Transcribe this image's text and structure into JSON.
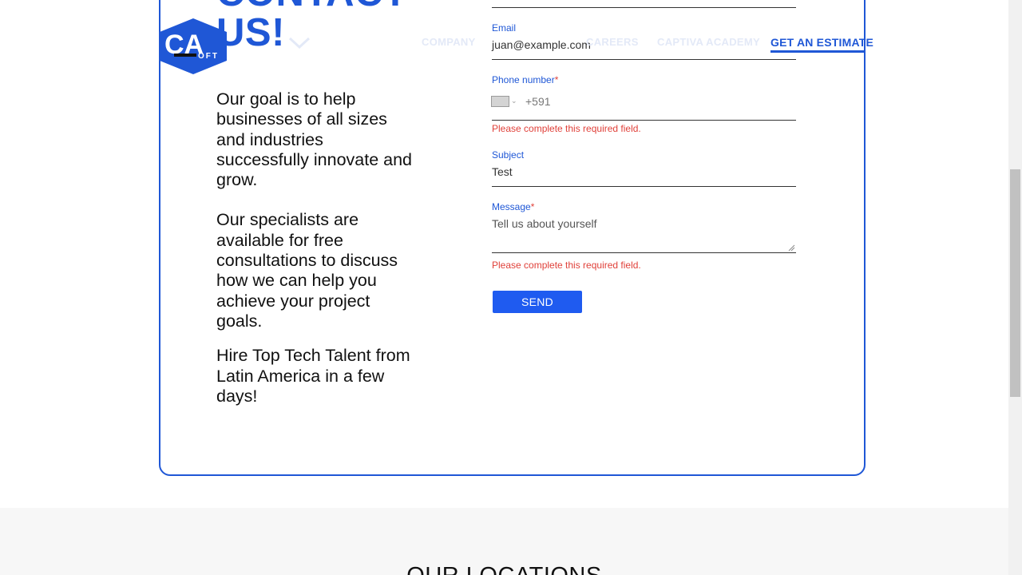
{
  "header": {
    "logo_text": "CA",
    "logo_subtext": "OFT",
    "nav": [
      "COMPANY",
      "CAREERS",
      "CAPTIVA ACADEMY"
    ],
    "cta": "GET AN ESTIMATE"
  },
  "contact": {
    "heading_line1": "CONTACT",
    "heading_line2": "US!",
    "paragraphs": [
      "Our goal is to help businesses of all sizes and industries successfully innovate and grow.",
      "Our specialists are available for free consultations to discuss how we can help you achieve your project goals.",
      "Hire Top Tech Talent from Latin America in a few days!"
    ]
  },
  "form": {
    "email": {
      "label": "Email",
      "value": "juan@example.com"
    },
    "phone": {
      "label": "Phone number",
      "required_mark": "*",
      "prefix": "+591",
      "error": "Please complete this required field."
    },
    "subject": {
      "label": "Subject",
      "value": "Test"
    },
    "message": {
      "label": "Message",
      "required_mark": "*",
      "placeholder": "Tell us about yourself",
      "error": "Please complete this required field."
    },
    "send_label": "SEND"
  },
  "locations": {
    "title": "OUR LOCATIONS"
  },
  "colors": {
    "brand_blue": "#1f57d6",
    "error_red": "#e0413a",
    "button_blue": "#1f5bf0"
  }
}
